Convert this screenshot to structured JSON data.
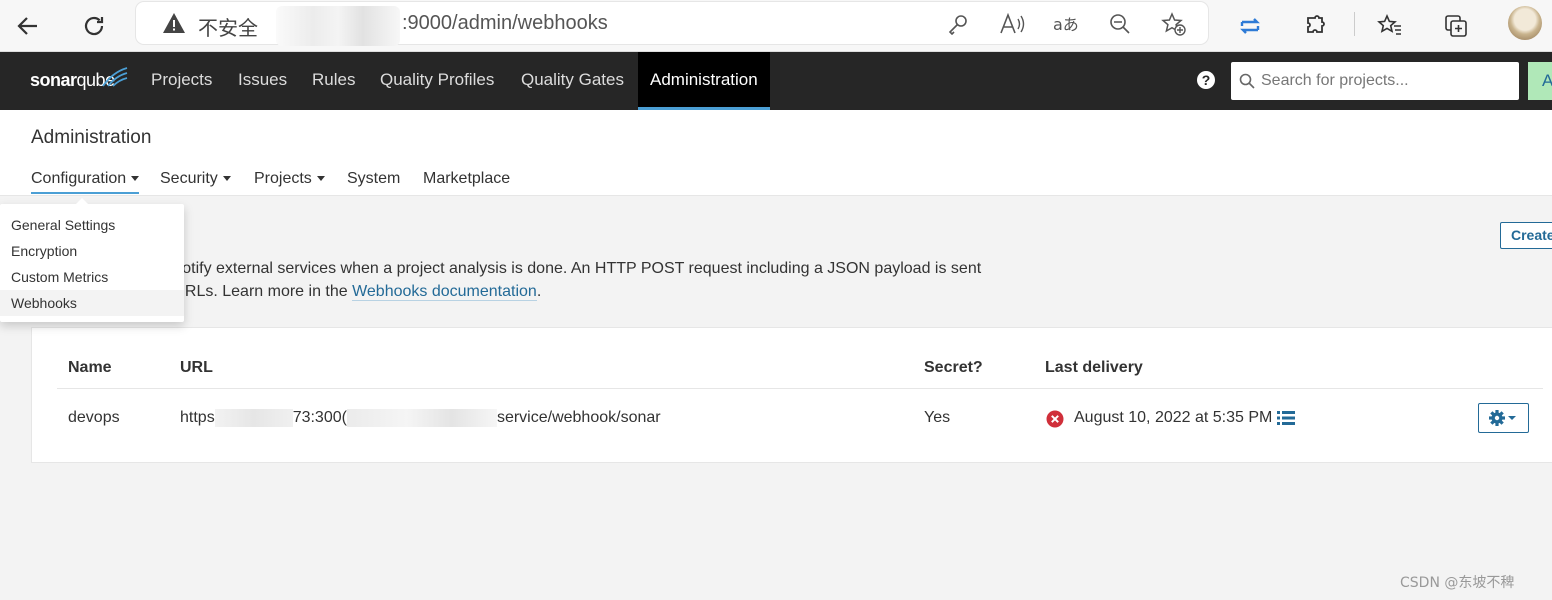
{
  "browser": {
    "insecure_label": "不安全",
    "url_suffix": ":9000/admin/webhooks"
  },
  "nav": {
    "logo_bold": "sonar",
    "logo_light": "qube",
    "items": [
      "Projects",
      "Issues",
      "Rules",
      "Quality Profiles",
      "Quality Gates",
      "Administration"
    ],
    "active_item": "Administration",
    "search_placeholder": "Search for projects...",
    "cta_label": "A"
  },
  "admin": {
    "title": "Administration",
    "tabs": [
      "Configuration",
      "Security",
      "Projects",
      "System",
      "Marketplace"
    ],
    "active_tab": "Configuration"
  },
  "dropdown": {
    "items": [
      "General Settings",
      "Encryption",
      "Custom Metrics",
      "Webhooks"
    ],
    "active": "Webhooks"
  },
  "webhooks": {
    "create_label": "Create",
    "desc_line1": "o notify external services when a project analysis is done. An HTTP POST request including a JSON payload is sent",
    "desc_line2_prefix": "d URLs. Learn more in the ",
    "desc_link": "Webhooks documentation",
    "desc_line2_suffix": ".",
    "columns": [
      "Name",
      "URL",
      "Secret?",
      "Last delivery"
    ],
    "rows": [
      {
        "name": "devops",
        "url_start": "https",
        "url_mid": "73:300(",
        "url_end": "service/webhook/sonar",
        "secret": "Yes",
        "last_delivery": "August 10, 2022 at 5:35 PM",
        "delivery_status": "error"
      }
    ]
  },
  "watermark": "CSDN @东坡不稗",
  "colors": {
    "nav_bg": "#262626",
    "link": "#236a97",
    "accent": "#4b9fd5",
    "error": "#d02f3a"
  }
}
